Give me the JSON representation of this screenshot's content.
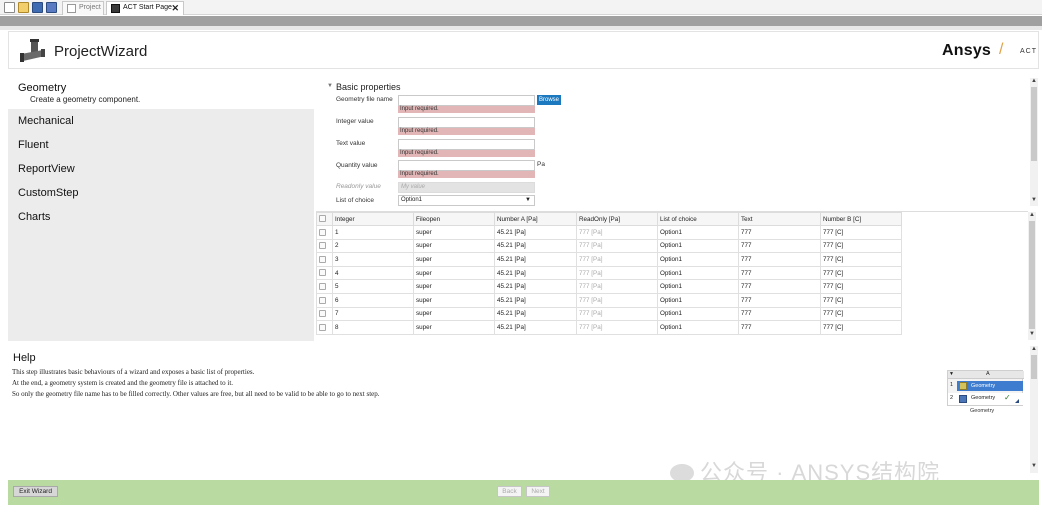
{
  "tabs": {
    "project_label": "Project",
    "start_page_label": "ACT Start Page",
    "close_glyph": "✕"
  },
  "header": {
    "title": "ProjectWizard",
    "brand": "Ansys",
    "brand_sep": "/",
    "brand_sub": "ACT",
    "accent_color": "#e0a34a"
  },
  "nav": {
    "items": [
      {
        "label": "Geometry",
        "sub": "Create a geometry component."
      },
      {
        "label": "Mechanical"
      },
      {
        "label": "Fluent"
      },
      {
        "label": "ReportView"
      },
      {
        "label": "CustomStep"
      },
      {
        "label": "Charts"
      }
    ]
  },
  "props": {
    "group_label": "Basic properties",
    "browse_label": "Browse",
    "error_text": "Input required.",
    "fields": {
      "geometry_file": {
        "label": "Geometry file name",
        "value": ""
      },
      "integer": {
        "label": "Integer value",
        "value": ""
      },
      "text": {
        "label": "Text value",
        "value": ""
      },
      "quantity": {
        "label": "Quantity value",
        "value": "",
        "unit": "Pa"
      },
      "readonly": {
        "label": "Readonly value",
        "placeholder": "My value"
      },
      "choice": {
        "label": "List of choice",
        "value": "Option1"
      }
    }
  },
  "table": {
    "columns": [
      "Integer",
      "Fileopen",
      "Number A [Pa]",
      "ReadOnly [Pa]",
      "List of choice",
      "Text",
      "Number B [C]"
    ],
    "rows": [
      [
        "1",
        "super",
        "45.21 [Pa]",
        "777 [Pa]",
        "Option1",
        "777",
        "777 [C]"
      ],
      [
        "2",
        "super",
        "45.21 [Pa]",
        "777 [Pa]",
        "Option1",
        "777",
        "777 [C]"
      ],
      [
        "3",
        "super",
        "45.21 [Pa]",
        "777 [Pa]",
        "Option1",
        "777",
        "777 [C]"
      ],
      [
        "4",
        "super",
        "45.21 [Pa]",
        "777 [Pa]",
        "Option1",
        "777",
        "777 [C]"
      ],
      [
        "5",
        "super",
        "45.21 [Pa]",
        "777 [Pa]",
        "Option1",
        "777",
        "777 [C]"
      ],
      [
        "6",
        "super",
        "45.21 [Pa]",
        "777 [Pa]",
        "Option1",
        "777",
        "777 [C]"
      ],
      [
        "7",
        "super",
        "45.21 [Pa]",
        "777 [Pa]",
        "Option1",
        "777",
        "777 [C]"
      ],
      [
        "8",
        "super",
        "45.21 [Pa]",
        "777 [Pa]",
        "Option1",
        "777",
        "777 [C]"
      ]
    ]
  },
  "help": {
    "title": "Help",
    "lines": [
      "This step illustrates basic behaviours of a wizard and exposes a basic list of properties.",
      "At the end, a geometry system is created and the geometry file is attached to it.",
      "So only the geometry file name has to be filled correctly. Other values are free, but all need to be valid to be able to go to next step."
    ],
    "mini_system": {
      "col_header": "A",
      "row1_num": "1",
      "row1_label": "Geometry",
      "row2_num": "2",
      "row2_label": "Geometry",
      "row2_check": "✓",
      "caption": "Geometry"
    }
  },
  "watermark": "公众号 · ANSYS结构院",
  "footer": {
    "exit_label": "Exit Wizard",
    "back_label": "Back",
    "next_label": "Next",
    "bar_color": "#b9dba2"
  }
}
